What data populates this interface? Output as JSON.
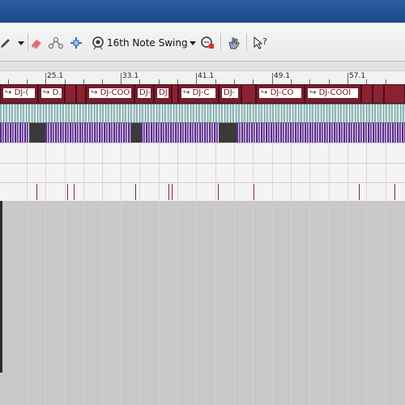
{
  "toolbar": {
    "swing_label": "16th Note Swing",
    "icons": [
      "pencil-icon",
      "dropdown-arrow-icon",
      "eraser-icon",
      "node-path-icon",
      "crosshair-icon",
      "swing-icon",
      "dropdown-arrow-icon",
      "snap-icon",
      "hand-icon",
      "help-pointer-icon"
    ]
  },
  "ruler": {
    "labels": [
      "25.1",
      "33.1",
      "41.1",
      "49.1",
      "57.1"
    ]
  },
  "clips": {
    "titles": [
      "DJ-(",
      "D...",
      "DJ-COO",
      "DJ-",
      "DJ",
      "DJ-C",
      "DJ-",
      "DJ-CO",
      "DJ-COOI"
    ]
  },
  "colors": {
    "clip_red": "#7a1c2c",
    "titlebar_blue": "#2b5fa3",
    "purple_audio": "#5b2d86",
    "cyan_audio": "#93b5b5"
  }
}
